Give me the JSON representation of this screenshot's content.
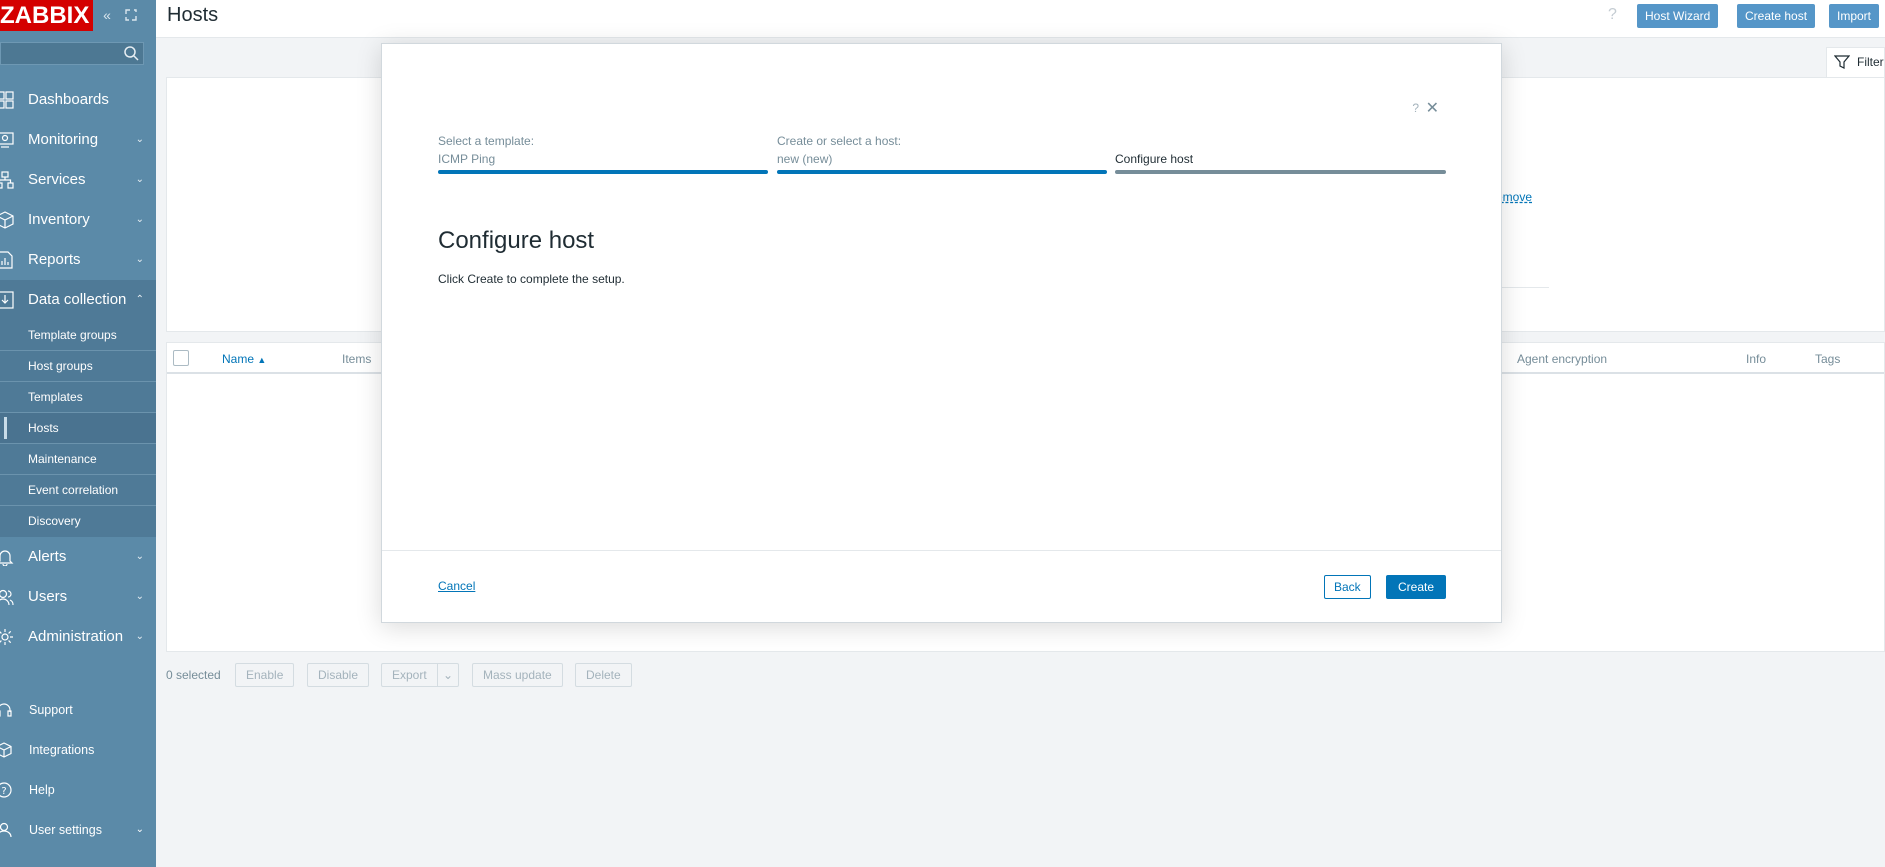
{
  "app": {
    "logo": "ZABBIX",
    "page_title": "Hosts"
  },
  "colors": {
    "sidebar": "#5b8aa8",
    "logo_bg": "#d40000",
    "accent": "#0275b8",
    "header_button": "#5596c8"
  },
  "sidebar": {
    "collapse_icon": "chevrons-left-icon",
    "kiosk_icon": "expand-icon",
    "search_placeholder": "",
    "items": [
      {
        "label": "Dashboards",
        "icon": "dashboard-grid-icon",
        "has_chevron": false
      },
      {
        "label": "Monitoring",
        "icon": "monitor-icon",
        "has_chevron": true
      },
      {
        "label": "Services",
        "icon": "hierarchy-icon",
        "has_chevron": true
      },
      {
        "label": "Inventory",
        "icon": "box-icon",
        "has_chevron": true
      },
      {
        "label": "Reports",
        "icon": "report-icon",
        "has_chevron": true
      },
      {
        "label": "Data collection",
        "icon": "download-icon",
        "has_chevron": true,
        "expanded": true
      }
    ],
    "sub_items": [
      "Template groups",
      "Host groups",
      "Templates",
      "Hosts",
      "Maintenance",
      "Event correlation",
      "Discovery"
    ],
    "active_sub_item": "Hosts",
    "items_after": [
      {
        "label": "Alerts",
        "icon": "bell-icon"
      },
      {
        "label": "Users",
        "icon": "users-icon"
      },
      {
        "label": "Administration",
        "icon": "gear-icon"
      }
    ],
    "bottom_items": [
      {
        "label": "Support",
        "icon": "headset-icon",
        "has_chevron": false
      },
      {
        "label": "Integrations",
        "icon": "cube-icon",
        "has_chevron": false
      },
      {
        "label": "Help",
        "icon": "help-circle-icon",
        "has_chevron": false
      },
      {
        "label": "User settings",
        "icon": "user-icon",
        "has_chevron": true
      }
    ]
  },
  "header": {
    "help": "?",
    "buttons": [
      "Host Wizard",
      "Create host",
      "Import"
    ]
  },
  "filter": {
    "tab_label": "Filter",
    "remove_link": "emove"
  },
  "table": {
    "columns": [
      "Name",
      "Items",
      "Agent encryption",
      "Info",
      "Tags"
    ],
    "sort_column": "Name"
  },
  "footer": {
    "selected": "0 selected",
    "actions": [
      "Enable",
      "Disable",
      "Export",
      "Mass update",
      "Delete"
    ]
  },
  "modal": {
    "help": "?",
    "close": "✕",
    "steps": [
      {
        "title": "Select a template:",
        "value": "ICMP Ping",
        "state": "done"
      },
      {
        "title": "Create or select a host:",
        "value": "new (new)",
        "state": "done"
      },
      {
        "title": "",
        "value": "Configure host",
        "state": "current"
      }
    ],
    "heading": "Configure host",
    "text": "Click Create to complete the setup.",
    "cancel": "Cancel",
    "back": "Back",
    "create": "Create"
  }
}
